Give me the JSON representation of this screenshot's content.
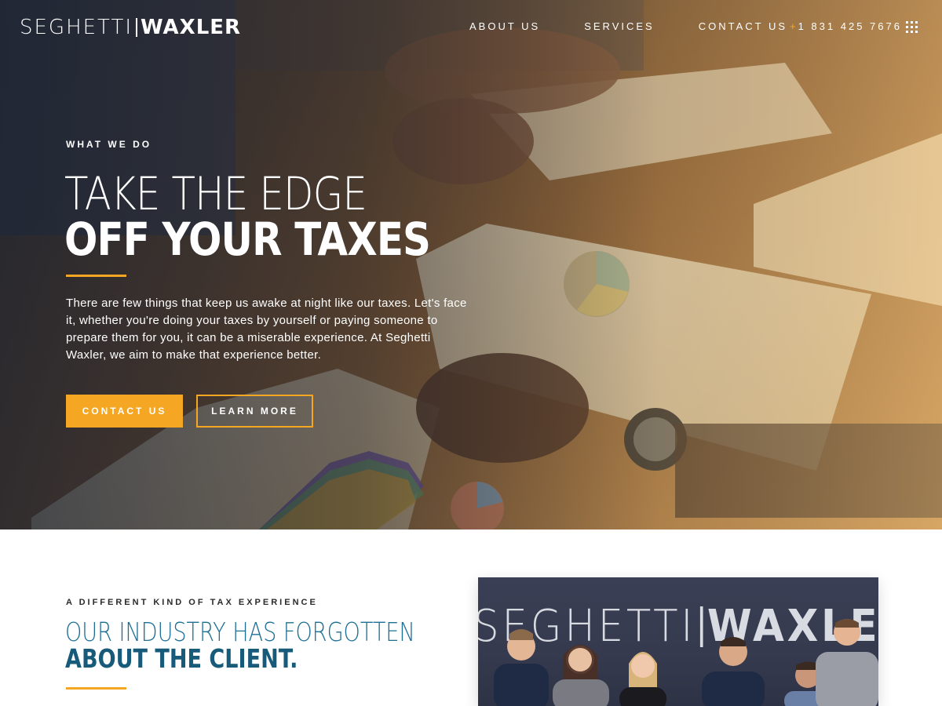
{
  "brand": {
    "name_light": "SEGHETTI",
    "name_bold": "WAXLER"
  },
  "nav": {
    "links": [
      "ABOUT US",
      "SERVICES",
      "CONTACT US"
    ],
    "phone_plus": "+",
    "phone": "1 831 425 7676",
    "menu_icon": "grid-menu-icon"
  },
  "hero": {
    "eyebrow": "WHAT WE DO",
    "headline_line1": "TAKE THE EDGE",
    "headline_line2": "OFF YOUR TAXES",
    "body": "There are few things that keep us awake at night like our taxes. Let's face it, whether you're doing your taxes by yourself or paying someone to prepare them for you, it can be a miserable experience. At Seghetti Waxler, we aim to make that experience better.",
    "primary_button": "CONTACT US",
    "secondary_button": "LEARN MORE"
  },
  "section2": {
    "eyebrow": "A DIFFERENT KIND OF TAX EXPERIENCE",
    "title_line1": "OUR INDUSTRY HAS FORGOTTEN",
    "title_line2": "ABOUT THE CLIENT.",
    "photo_sign_light": "SEGHETTI",
    "photo_sign_bold": "WAXLER"
  },
  "colors": {
    "accent": "#f5a623",
    "heading_blue": "#1e6f94",
    "hero_overlay": "#1e283a"
  }
}
